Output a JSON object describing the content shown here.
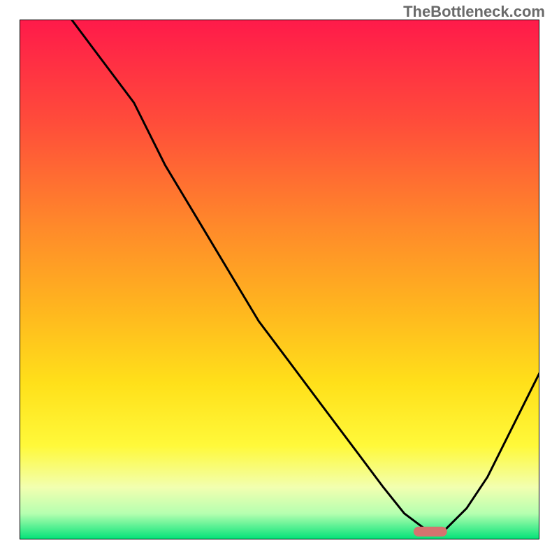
{
  "watermark": "TheBottleneck.com",
  "chart_data": {
    "type": "line",
    "title": "",
    "xlabel": "",
    "ylabel": "",
    "xlim": [
      0,
      100
    ],
    "ylim": [
      0,
      100
    ],
    "grid": false,
    "series": [
      {
        "name": "curve",
        "x": [
          10,
          16,
          22,
          28,
          34,
          40,
          46,
          52,
          58,
          64,
          70,
          74,
          78,
          82,
          86,
          90,
          95,
          100
        ],
        "y": [
          100,
          92,
          84,
          72,
          62,
          52,
          42,
          34,
          26,
          18,
          10,
          5,
          2,
          2,
          6,
          12,
          22,
          32
        ]
      }
    ],
    "marker": {
      "x": 79,
      "y": 1.5,
      "color": "#d6736f"
    },
    "background_gradient": {
      "stops": [
        {
          "offset": 0.0,
          "color": "#ff1a4a"
        },
        {
          "offset": 0.2,
          "color": "#ff4d3a"
        },
        {
          "offset": 0.4,
          "color": "#ff8a2a"
        },
        {
          "offset": 0.55,
          "color": "#ffb41f"
        },
        {
          "offset": 0.7,
          "color": "#ffe01a"
        },
        {
          "offset": 0.82,
          "color": "#fff93a"
        },
        {
          "offset": 0.9,
          "color": "#f2ffb0"
        },
        {
          "offset": 0.95,
          "color": "#b6ffb0"
        },
        {
          "offset": 1.0,
          "color": "#00e278"
        }
      ]
    }
  }
}
